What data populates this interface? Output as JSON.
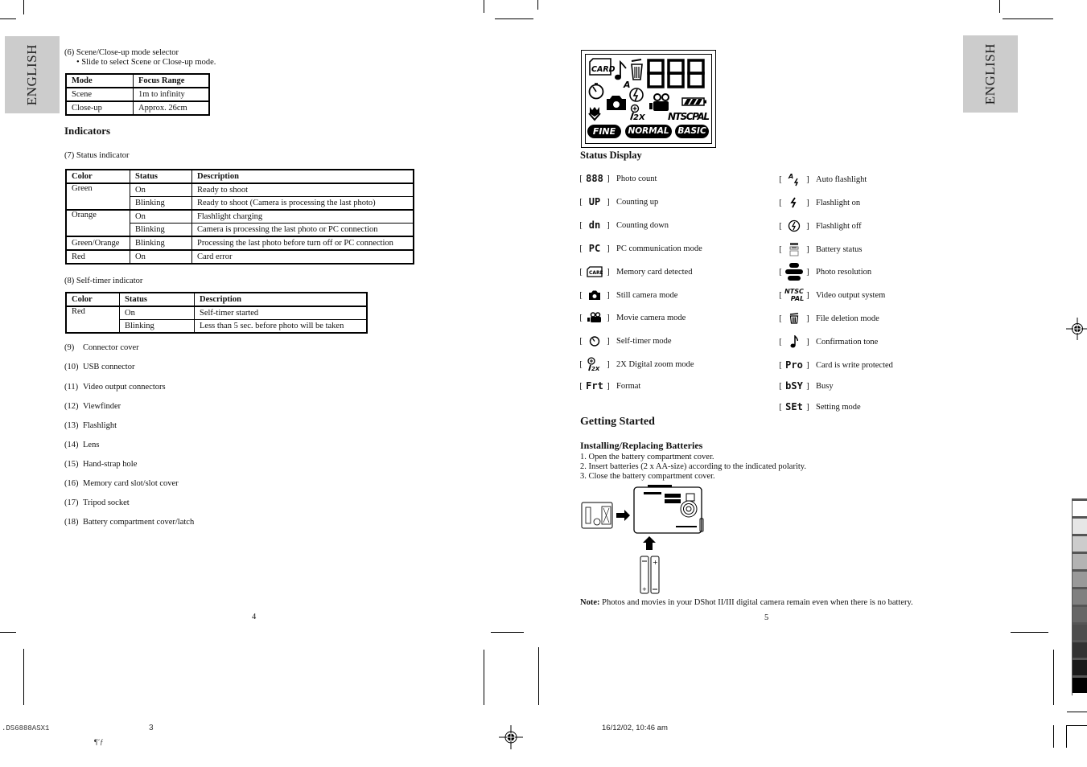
{
  "left_page": {
    "lang_tab": "ENGLISH",
    "item6": {
      "title": "(6) Scene/Close-up mode selector",
      "bullet": "•  Slide to select Scene or Close-up mode.",
      "table": {
        "headers": [
          "Mode",
          "Focus Range"
        ],
        "rows": [
          [
            "Scene",
            "1m to infinity"
          ],
          [
            "Close-up",
            "Approx. 26cm"
          ]
        ]
      }
    },
    "indicators_heading": "Indicators",
    "item7": {
      "title": "(7) Status indicator",
      "table": {
        "headers": [
          "Color",
          "Status",
          "Description"
        ],
        "rows": [
          [
            "Green",
            "On",
            "Ready to shoot"
          ],
          [
            "",
            "Blinking",
            "Ready to shoot (Camera is processing the last photo)"
          ],
          [
            "Orange",
            "On",
            "Flashlight charging"
          ],
          [
            "",
            "Blinking",
            "Camera is processing the last photo or PC connection"
          ],
          [
            "Green/Orange",
            "Blinking",
            "Processing the last photo before turn off or PC connection"
          ],
          [
            "Red",
            "On",
            "Card error"
          ]
        ]
      }
    },
    "item8": {
      "title": "(8) Self-timer indicator",
      "table": {
        "headers": [
          "Color",
          "Status",
          "Description"
        ],
        "rows": [
          [
            "Red",
            "On",
            "Self-timer started"
          ],
          [
            "",
            "Blinking",
            "Less than 5 sec. before photo will be taken"
          ]
        ]
      }
    },
    "parts": [
      {
        "num": "(9)",
        "label": "Connector cover"
      },
      {
        "num": "(10)",
        "label": "USB connector"
      },
      {
        "num": "(11)",
        "label": "Video output connectors"
      },
      {
        "num": "(12)",
        "label": "Viewfinder"
      },
      {
        "num": "(13)",
        "label": "Flashlight"
      },
      {
        "num": "(14)",
        "label": "Lens"
      },
      {
        "num": "(15)",
        "label": "Hand-strap hole"
      },
      {
        "num": "(16)",
        "label": "Memory card slot/slot cover"
      },
      {
        "num": "(17)",
        "label": "Tripod socket"
      },
      {
        "num": "(18)",
        "label": "Battery compartment cover/latch"
      }
    ],
    "page_number": "4"
  },
  "right_page": {
    "lang_tab": "ENGLISH",
    "lcd": {
      "card": "CARD",
      "digits": "888",
      "auto": "A",
      "zoom": "2X",
      "ntscpal": "NTSCPAL",
      "fine": "FINE",
      "normal": "NORMAL",
      "basic": "BASIC"
    },
    "status_display_heading": "Status Display",
    "indicators_left": [
      {
        "icon": "888",
        "label": "Photo count"
      },
      {
        "icon": "UP",
        "label": "Counting up"
      },
      {
        "icon": "dn",
        "label": "Counting down"
      },
      {
        "icon": "PC",
        "label": "PC communication mode"
      },
      {
        "icon": "card-icon",
        "label": "Memory card detected"
      },
      {
        "icon": "still-camera-icon",
        "label": "Still camera mode"
      },
      {
        "icon": "movie-camera-icon",
        "label": "Movie camera mode"
      },
      {
        "icon": "self-timer-icon",
        "label": "Self-timer mode"
      },
      {
        "icon": "digital-zoom-icon",
        "label": "2X Digital zoom mode"
      },
      {
        "icon": "Frt",
        "label": "Format"
      }
    ],
    "indicators_right": [
      {
        "icon": "auto-flash-icon",
        "label": "Auto flashlight"
      },
      {
        "icon": "flash-icon",
        "label": "Flashlight on"
      },
      {
        "icon": "flash-off-icon",
        "label": "Flashlight off"
      },
      {
        "icon": "battery-icon",
        "label": "Battery status"
      },
      {
        "icon": "resolution-icon",
        "label": "Photo resolution"
      },
      {
        "icon": "ntsc-pal-icon",
        "label": "Video output system",
        "ntsc": "NTSC",
        "pal": "PAL"
      },
      {
        "icon": "trash-icon",
        "label": "File deletion mode"
      },
      {
        "icon": "note-icon",
        "label": "Confirmation tone"
      },
      {
        "icon": "Pro",
        "label": "Card is write protected"
      },
      {
        "icon": "bSY",
        "label": "Busy"
      },
      {
        "icon": "SEt",
        "label": "Setting mode"
      }
    ],
    "getting_started_heading": "Getting Started",
    "batteries_heading": "Installing/Replacing Batteries",
    "steps": [
      "1.   Open the battery compartment cover.",
      "2.   Insert batteries (2 x AA-size) according to the indicated polarity.",
      "3.   Close the battery compartment cover."
    ],
    "note_label": "Note:",
    "note_text": " Photos and movies in your DShot II/III digital camera remain even when there is no battery.",
    "page_number": "5"
  },
  "slug": {
    "file": ".DS6888ASX1",
    "sheet": "3",
    "mark": "¶˘ƒ",
    "timestamp": "16/12/02, 10:46 am"
  },
  "gray_scale": [
    "#ffffff",
    "#e6e6e6",
    "#cccccc",
    "#b3b3b3",
    "#999999",
    "#808080",
    "#666666",
    "#4d4d4d",
    "#333333",
    "#1a1a1a",
    "#000000"
  ]
}
